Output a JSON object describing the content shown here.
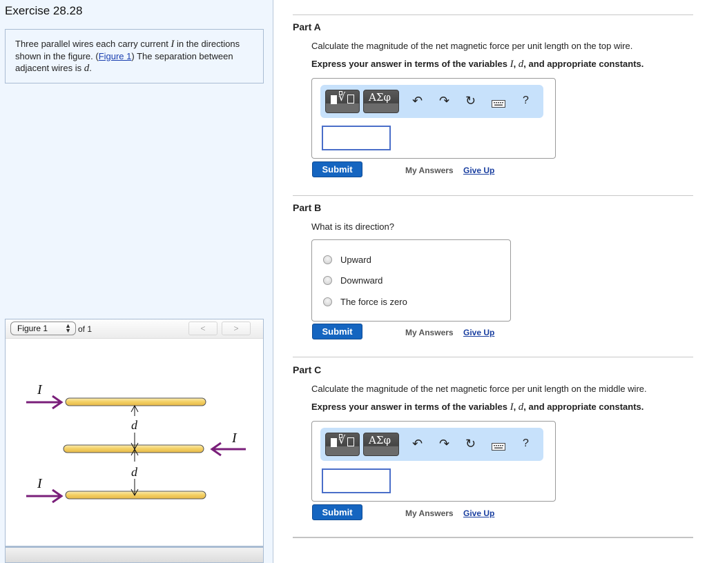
{
  "exercise": {
    "title": "Exercise 28.28",
    "intro": {
      "text_1": "Three parallel wires each carry current ",
      "var_I": "I",
      "text_2": " in the directions shown in the figure. (",
      "figure_link": "Figure 1",
      "text_3": ") The separation between adjacent wires is ",
      "var_d": "d",
      "text_4": "."
    }
  },
  "figure_viewer": {
    "selected": "Figure 1",
    "of_label": "of 1",
    "prev_label": "<",
    "next_label": ">",
    "figure": {
      "wire_labels": [
        "I",
        "I",
        "I"
      ],
      "current_directions": [
        "right",
        "left",
        "right"
      ],
      "separation_labels": [
        "d",
        "d"
      ],
      "wire_color": "#f5d77a",
      "arrow_color": "#7a1f7a"
    }
  },
  "parts": [
    {
      "title": "Part A",
      "question": "Calculate the magnitude of the net magnetic force per unit length on the top wire.",
      "instruction_pre": "Express your answer in terms of the variables ",
      "instruction_var1": "I",
      "instruction_mid": ", ",
      "instruction_var2": "d",
      "instruction_post": ", and appropriate constants.",
      "answer_value": "",
      "toolbar": {
        "greek_label": "ΑΣφ",
        "undo": "↶",
        "redo": "↷",
        "reset": "↻",
        "help": "?"
      },
      "submit_label": "Submit",
      "my_answers_label": "My Answers",
      "give_up_label": "Give Up"
    },
    {
      "title": "Part B",
      "question": "What is its direction?",
      "options": [
        "Upward",
        "Downward",
        "The force is zero"
      ],
      "submit_label": "Submit",
      "my_answers_label": "My Answers",
      "give_up_label": "Give Up"
    },
    {
      "title": "Part C",
      "question": "Calculate the magnitude of the net magnetic force per unit length on the middle wire.",
      "instruction_pre": "Express your answer in terms of the variables ",
      "instruction_var1": "I",
      "instruction_mid": ", ",
      "instruction_var2": "d",
      "instruction_post": ", and appropriate constants.",
      "answer_value": "",
      "toolbar": {
        "greek_label": "ΑΣφ",
        "undo": "↶",
        "redo": "↷",
        "reset": "↻",
        "help": "?"
      },
      "submit_label": "Submit",
      "my_answers_label": "My Answers",
      "give_up_label": "Give Up"
    }
  ],
  "colors": {
    "submit_bg": "#1565c0",
    "toolbar_bg": "#c7e1fb",
    "left_panel_bg": "#eff6fe",
    "link": "#1a3fa0"
  }
}
